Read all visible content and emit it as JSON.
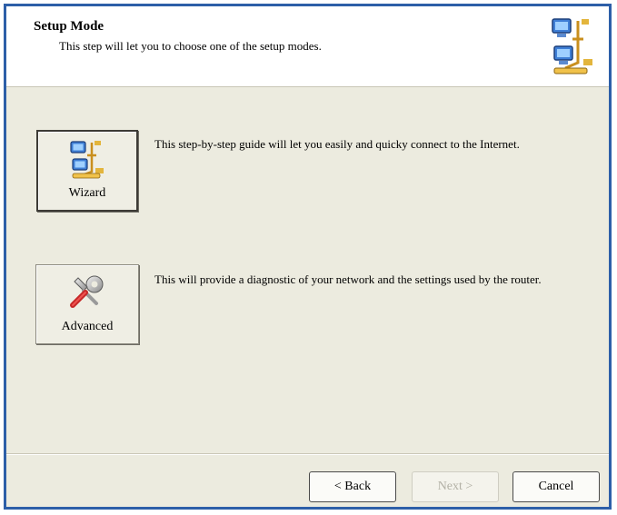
{
  "header": {
    "title": "Setup Mode",
    "subtitle": "This step will let you to choose one of the setup modes.",
    "icon": "network-computer-icon"
  },
  "modes": [
    {
      "label": "Wizard",
      "icon": "network-computer-icon",
      "description": "This step-by-step guide will let you easily and quicky connect to the Internet."
    },
    {
      "label": "Advanced",
      "icon": "tools-wrench-icon",
      "description": "This will provide a diagnostic of your network and the settings used by the router."
    }
  ],
  "footer": {
    "back_label": "< Back",
    "next_label": "Next >",
    "cancel_label": "Cancel"
  },
  "colors": {
    "window_border": "#2d5fa8",
    "dialog_background": "#ecebdf",
    "header_background": "#ffffff"
  }
}
